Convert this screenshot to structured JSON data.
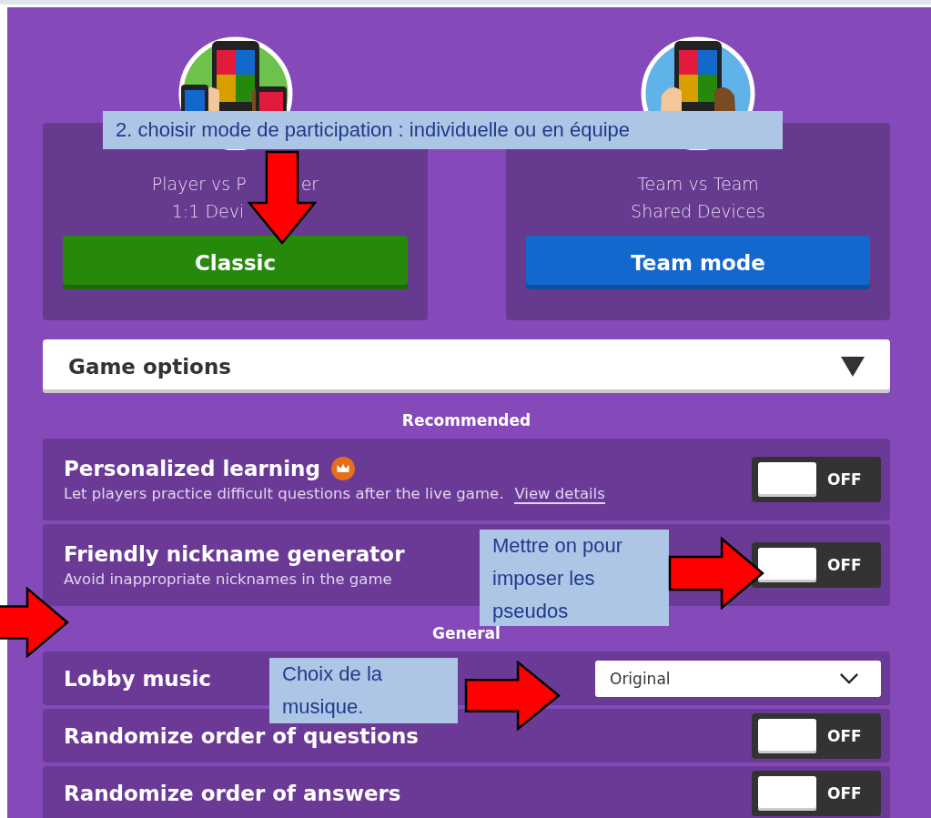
{
  "modes": [
    {
      "kind": "classic",
      "lines": [
        {
          "parts": [
            "Player vs P",
            "er"
          ],
          "gap_between": true,
          "gap_after": false
        },
        {
          "parts": [
            "1:1 Devi"
          ],
          "gap_after": true
        }
      ],
      "button": "Classic"
    },
    {
      "kind": "team",
      "lines": [
        {
          "parts": [
            "Team vs Team"
          ]
        },
        {
          "parts": [
            "Shared Devices"
          ]
        }
      ],
      "button": "Team mode"
    }
  ],
  "game_options": {
    "title": "Game options",
    "expanded": true
  },
  "sections": [
    {
      "title": "Recommended",
      "rows": [
        {
          "kind": "toggle",
          "label": "Personalized learning",
          "premium": true,
          "description": "Let players practice difficult questions after the live game.",
          "link": "View details",
          "on": false,
          "state_label": "OFF"
        },
        {
          "kind": "toggle",
          "label": "Friendly nickname generator",
          "premium": false,
          "description": "Avoid inappropriate nicknames in the game",
          "on": false,
          "state_label": "OFF"
        }
      ]
    },
    {
      "title": "General",
      "rows": [
        {
          "kind": "select",
          "label": "Lobby music",
          "value": "Original"
        },
        {
          "kind": "toggle",
          "label": "Randomize order of questions",
          "on": false,
          "state_label": "OFF"
        },
        {
          "kind": "toggle",
          "label": "Randomize order of answers",
          "on": false,
          "state_label": "OFF"
        }
      ]
    }
  ],
  "annotations": [
    {
      "kind": "callout",
      "text": "2. choisir mode de participation : individuelle ou en équipe"
    },
    {
      "kind": "callout",
      "text": "Mettre on pour imposer les pseudos"
    },
    {
      "kind": "callout",
      "text": "Choix de la musique."
    }
  ]
}
